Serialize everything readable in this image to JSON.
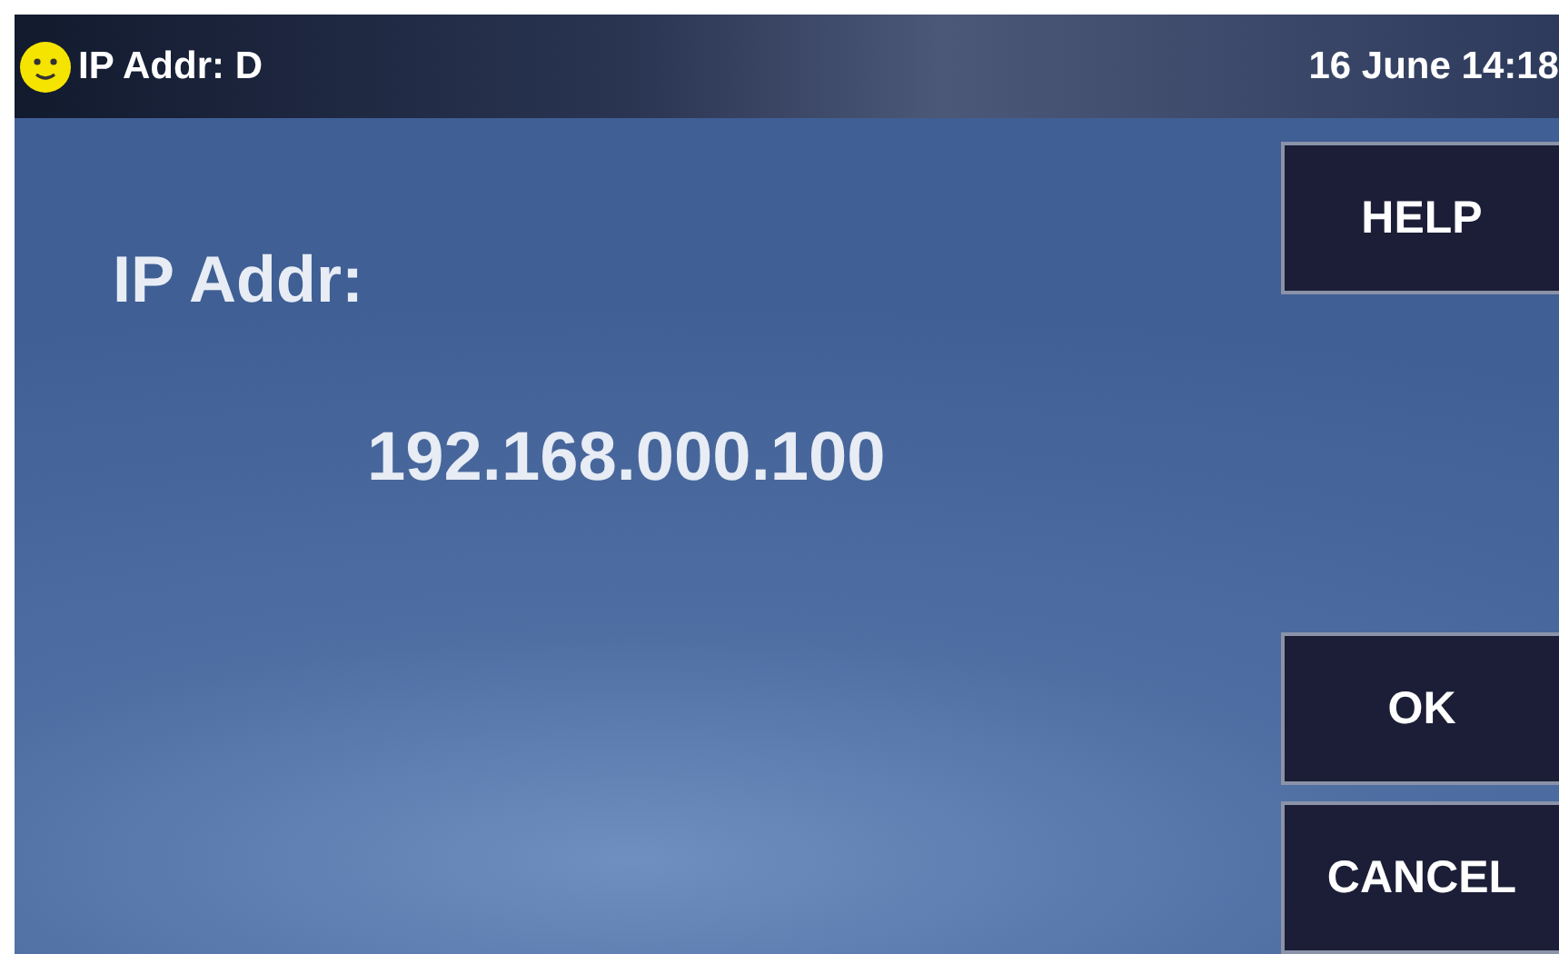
{
  "status_bar": {
    "title": "IP Addr: D",
    "datetime": "16 June 14:18"
  },
  "field": {
    "label": "IP Addr:",
    "value": "192.168.000.100"
  },
  "buttons": [
    {
      "label": "HELP",
      "kind": "help"
    },
    {
      "label": "OK",
      "kind": "dialog"
    },
    {
      "label": "CANCEL",
      "kind": "dialog"
    }
  ]
}
